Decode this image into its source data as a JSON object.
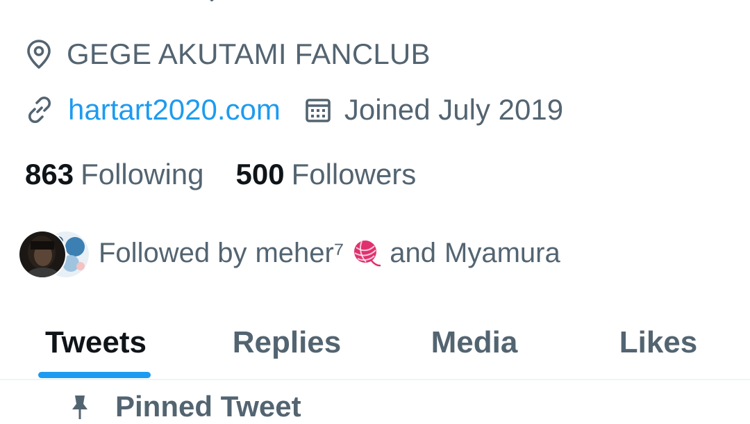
{
  "profile": {
    "location": "GEGE AKUTAMI FANCLUB",
    "website": "hartart2020.com",
    "joined": "Joined July 2019",
    "following_count": "863",
    "following_label": "Following",
    "followers_count": "500",
    "followers_label": "Followers",
    "followed_by": {
      "prefix": "Followed by",
      "user1": "meher⁷",
      "conjunction": "and",
      "user2": "Myamura"
    }
  },
  "tabs": [
    {
      "label": "Tweets",
      "active": true
    },
    {
      "label": "Replies",
      "active": false
    },
    {
      "label": "Media",
      "active": false
    },
    {
      "label": "Likes",
      "active": false
    }
  ],
  "pinned": {
    "label": "Pinned Tweet"
  },
  "colors": {
    "text_primary": "#0f1419",
    "text_secondary": "#536471",
    "accent": "#1d9bf0",
    "divider": "#eff3f4",
    "yarn": "#e0316f"
  },
  "icons": {
    "location": "map-pin-icon",
    "website": "link-icon",
    "joined": "calendar-icon",
    "pinned": "pin-icon",
    "top": "chevron-down-icon"
  }
}
